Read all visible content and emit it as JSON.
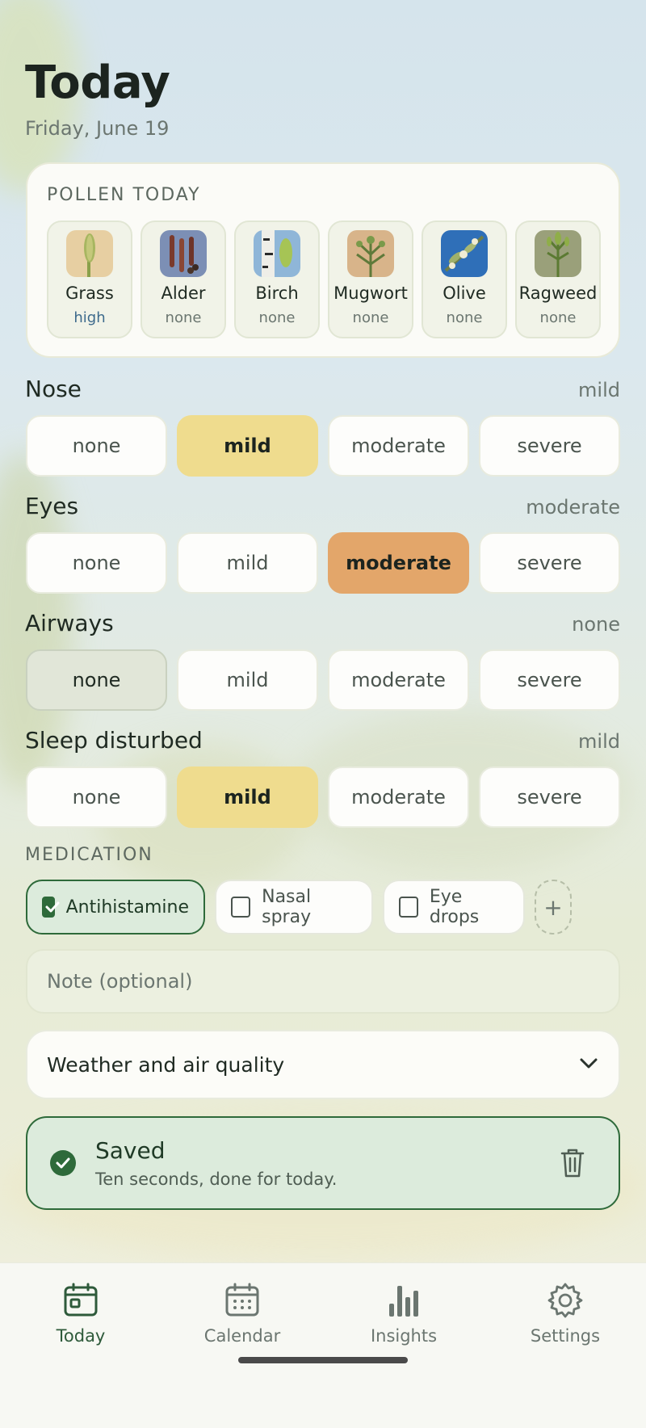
{
  "header": {
    "title": "Today",
    "date": "Friday, June 19"
  },
  "pollen": {
    "heading": "POLLEN TODAY",
    "items": [
      {
        "name": "Grass",
        "level": "high",
        "icon": "grass-image"
      },
      {
        "name": "Alder",
        "level": "none",
        "icon": "alder-image"
      },
      {
        "name": "Birch",
        "level": "none",
        "icon": "birch-image"
      },
      {
        "name": "Mugwort",
        "level": "none",
        "icon": "mugwort-image"
      },
      {
        "name": "Olive",
        "level": "none",
        "icon": "olive-image"
      },
      {
        "name": "Ragweed",
        "level": "none",
        "icon": "ragweed-image"
      }
    ]
  },
  "symptoms": [
    {
      "label": "Nose",
      "value": "mild",
      "options": [
        "none",
        "mild",
        "moderate",
        "severe"
      ]
    },
    {
      "label": "Eyes",
      "value": "moderate",
      "options": [
        "none",
        "mild",
        "moderate",
        "severe"
      ]
    },
    {
      "label": "Airways",
      "value": "none",
      "options": [
        "none",
        "mild",
        "moderate",
        "severe"
      ]
    },
    {
      "label": "Sleep disturbed",
      "value": "mild",
      "options": [
        "none",
        "mild",
        "moderate",
        "severe"
      ]
    }
  ],
  "medication": {
    "heading": "MEDICATION",
    "items": [
      {
        "label": "Antihistamine",
        "checked": true
      },
      {
        "label": "Nasal spray",
        "checked": false
      },
      {
        "label": "Eye drops",
        "checked": false
      }
    ],
    "add_label": "+"
  },
  "note": {
    "placeholder": "Note (optional)"
  },
  "weather": {
    "label": "Weather and air quality"
  },
  "saved": {
    "title": "Saved",
    "subtitle": "Ten seconds, done for today."
  },
  "nav": {
    "items": [
      {
        "label": "Today",
        "icon": "calendar-day-icon",
        "active": true
      },
      {
        "label": "Calendar",
        "icon": "calendar-grid-icon",
        "active": false
      },
      {
        "label": "Insights",
        "icon": "bar-chart-icon",
        "active": false
      },
      {
        "label": "Settings",
        "icon": "gear-icon",
        "active": false
      }
    ]
  },
  "colors": {
    "accent": "#2e6a3a",
    "mild": "#efdc8e",
    "moderate": "#e3a66a",
    "none_selected": "#e1e6d8"
  }
}
